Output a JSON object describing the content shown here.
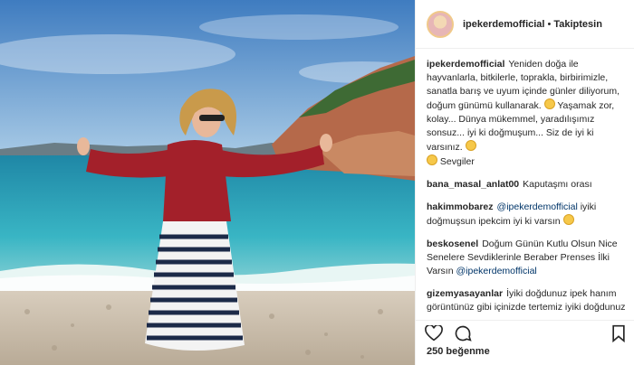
{
  "post": {
    "username": "ipekerdemofficial",
    "separator": "•",
    "follow_status": "Takiptesin",
    "likes": "250 beğenme"
  },
  "comments": [
    {
      "user": "ipekerdemofficial",
      "text": "Yeniden doğa ile hayvanlarla, bitkilerle, toprakla, birbirimizle, sanatla barış ve uyum içinde günler diliyorum, doğum günümü kullanarak.",
      "text2": "Yaşamak zor, kolay... Dünya mükemmel, yaradılışımız sonsuz... iyi ki doğmuşum... Siz de iyi ki varsınız.",
      "text3": "Sevgiler"
    },
    {
      "user": "bana_masal_anlat00",
      "text": "Kaputaşmı orası"
    },
    {
      "user": "hakimmobarez",
      "mention": "@ipekerdemofficial",
      "text": "iyiki doğmuşsun ipekcim iyi ki varsın"
    },
    {
      "user": "beskosenel",
      "text": "Doğum Günün Kutlu Olsun Nice Senelere Sevdiklerinle Beraber Prenses İlki Varsın",
      "mention": "@ipekerdemofficial"
    },
    {
      "user": "gizemyasayanlar",
      "text": "İyiki doğdunuz ipek hanım görüntünüz gibi içinizde tertemiz iyiki doğdunuz ve iyiki birşeyler paylaşarak bizimle güzel enerjinizi paylaşıyorsunuz .. tertemiz hayata tertemiz insanlarla olmanız"
    }
  ],
  "icons": [
    "heart-icon",
    "comment-icon",
    "bookmark-icon"
  ],
  "colors": {
    "sky": "#5d93c8",
    "sea": "#2aa4b8",
    "jacket": "#a3202a",
    "mention": "#003569"
  }
}
